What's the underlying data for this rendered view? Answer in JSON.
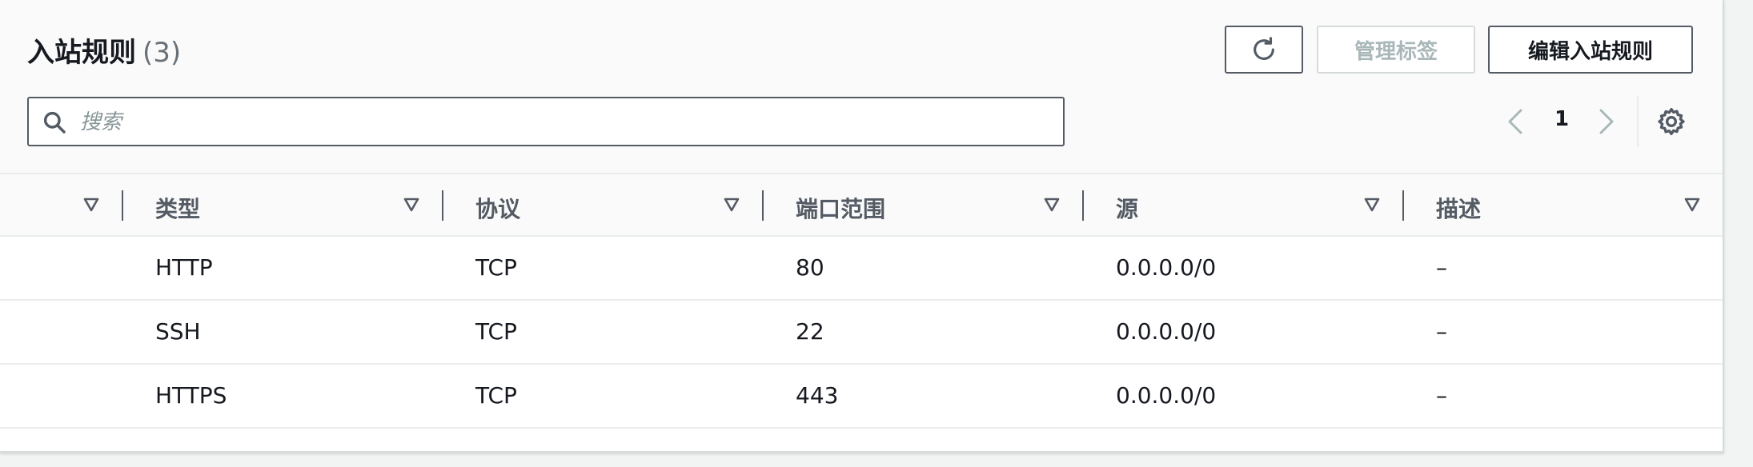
{
  "header": {
    "title": "入站规则",
    "count": "(3)",
    "manage_tags_label": "管理标签",
    "edit_rules_label": "编辑入站规则"
  },
  "search": {
    "placeholder": "搜索"
  },
  "pagination": {
    "current_page": "1"
  },
  "table": {
    "columns": [
      "类型",
      "协议",
      "端口范围",
      "源",
      "描述"
    ],
    "rows": [
      {
        "type": "HTTP",
        "protocol": "TCP",
        "port_range": "80",
        "source": "0.0.0.0/0",
        "description": "–"
      },
      {
        "type": "SSH",
        "protocol": "TCP",
        "port_range": "22",
        "source": "0.0.0.0/0",
        "description": "–"
      },
      {
        "type": "HTTPS",
        "protocol": "TCP",
        "port_range": "443",
        "source": "0.0.0.0/0",
        "description": "–"
      }
    ]
  },
  "icons": {
    "refresh": "refresh-icon",
    "search": "search-icon",
    "prev": "chevron-left-icon",
    "next": "chevron-right-icon",
    "settings": "gear-icon",
    "sort": "sort-caret-down-icon"
  },
  "colors": {
    "text_primary": "#16191f",
    "text_secondary": "#545b64",
    "disabled": "#aab7b8",
    "border": "#545b64"
  }
}
